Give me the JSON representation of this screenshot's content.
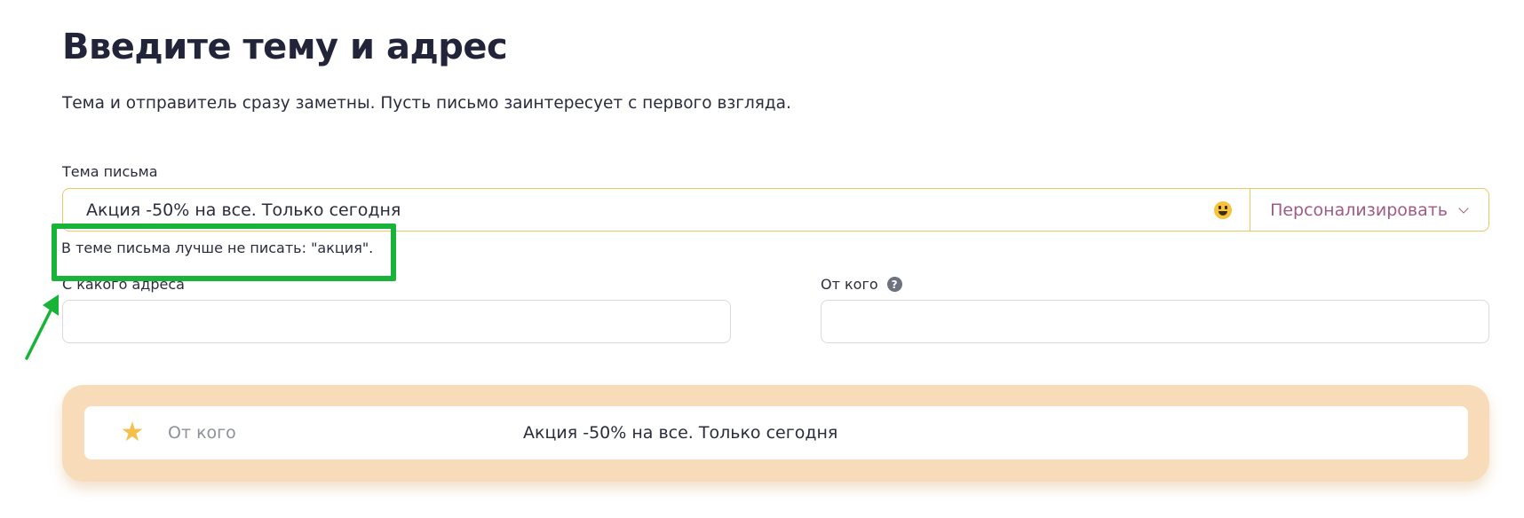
{
  "header": {
    "title": "Введите тему и адрес",
    "subtitle": "Тема и отправитель сразу заметны. Пусть письмо заинтересует с первого взгляда."
  },
  "subject": {
    "label": "Тема письма",
    "value": "Акция -50% на все. Только сегодня",
    "emoji_icon": "smiley-emoji-icon",
    "personalize_label": "Персонализировать",
    "warning": "В теме письма лучше не писать: \"акция\"."
  },
  "from_address": {
    "label": "С какого адреса",
    "value": ""
  },
  "from_name": {
    "label": "От кого",
    "help_icon": "?",
    "value": ""
  },
  "preview": {
    "star_icon": "★",
    "from": "От кого",
    "subject": "Акция -50% на все. Только сегодня"
  },
  "colors": {
    "accent_border": "#f0c661",
    "personalize": "#a05a85",
    "highlight": "#18b43a",
    "preview_bg": "#f8dcb9"
  }
}
